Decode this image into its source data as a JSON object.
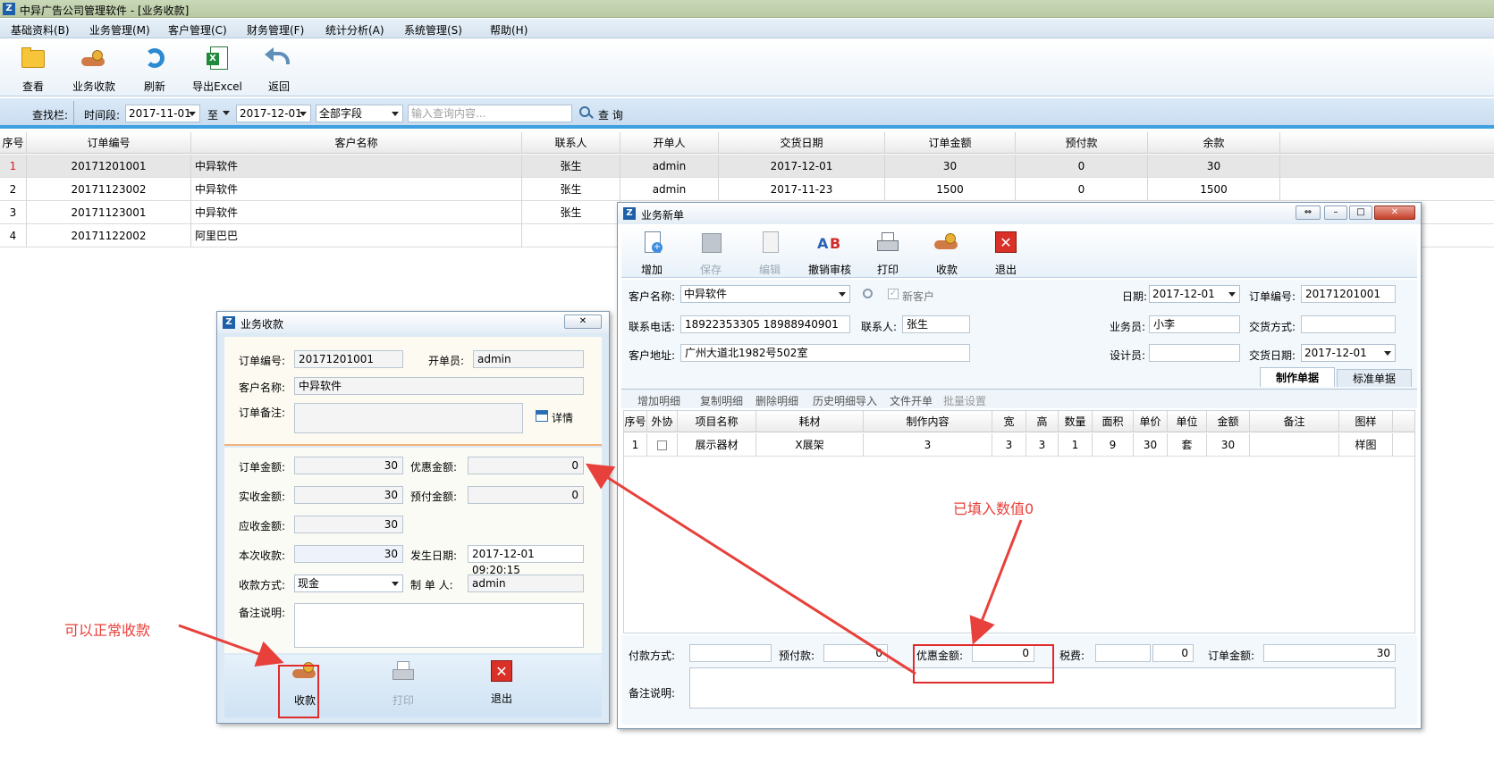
{
  "window": {
    "title": "中异广告公司管理软件 - [业务收款]",
    "menu": [
      "基础资料(B)",
      "业务管理(M)",
      "客户管理(C)",
      "财务管理(F)",
      "统计分析(A)",
      "系统管理(S)",
      "帮助(H)"
    ],
    "toolbar": [
      {
        "label": "查看",
        "icon": "folder-icon"
      },
      {
        "label": "业务收款",
        "icon": "money-hand-icon"
      },
      {
        "label": "刷新",
        "icon": "refresh-icon"
      },
      {
        "label": "导出Excel",
        "icon": "excel-icon"
      },
      {
        "label": "返回",
        "icon": "back-arrow-icon"
      }
    ]
  },
  "search": {
    "bar_label": "查找栏:",
    "period_label": "时间段:",
    "date_from": "2017-11-01",
    "to_label": "至",
    "date_to": "2017-12-01",
    "field": "全部字段",
    "placeholder": "输入查询内容...",
    "search_button": "查 询"
  },
  "grid": {
    "columns": [
      "序号",
      "订单编号",
      "客户名称",
      "联系人",
      "开单人",
      "交货日期",
      "订单金额",
      "预付款",
      "余款"
    ],
    "rows": [
      {
        "no": "1",
        "order": "20171201001",
        "customer": "中异软件",
        "contact": "张生",
        "creator": "admin",
        "date": "2017-12-01",
        "amount": "30",
        "prepay": "0",
        "balance": "30"
      },
      {
        "no": "2",
        "order": "20171123002",
        "customer": "中异软件",
        "contact": "张生",
        "creator": "admin",
        "date": "2017-11-23",
        "amount": "1500",
        "prepay": "0",
        "balance": "1500"
      },
      {
        "no": "3",
        "order": "20171123001",
        "customer": "中异软件",
        "contact": "张生",
        "creator": "",
        "date": "",
        "amount": "",
        "prepay": "",
        "balance": ""
      },
      {
        "no": "4",
        "order": "20171122002",
        "customer": "阿里巴巴",
        "contact": "",
        "creator": "",
        "date": "",
        "amount": "",
        "prepay": "",
        "balance": ""
      }
    ]
  },
  "payment_dialog": {
    "title": "业务收款",
    "order_no_label": "订单编号:",
    "order_no": "20171201001",
    "creator_label": "开单员:",
    "creator": "admin",
    "customer_label": "客户名称:",
    "customer": "中异软件",
    "remark_label": "订单备注:",
    "detail_button": "详情",
    "order_amount_label": "订单金额:",
    "order_amount": "30",
    "discount_label": "优惠金额:",
    "discount": "0",
    "actual_label": "实收金额:",
    "actual": "30",
    "prepay_label": "预付金额:",
    "prepay": "0",
    "receivable_label": "应收金额:",
    "receivable": "30",
    "this_time_label": "本次收款:",
    "this_time": "30",
    "occur_date_label": "发生日期:",
    "occur_date": "2017-12-01 09:20:15",
    "method_label": "收款方式:",
    "method": "现金",
    "maker_label": "制 单 人:",
    "maker": "admin",
    "note_label": "备注说明:",
    "buttons": [
      "收款",
      "打印",
      "退出"
    ]
  },
  "order_dialog": {
    "title": "业务新单",
    "toolbar": [
      "增加",
      "保存",
      "编辑",
      "撤销审核",
      "打印",
      "收款",
      "退出"
    ],
    "customer_label": "客户名称:",
    "customer": "中异软件",
    "new_customer_label": "新客户",
    "date_label": "日期:",
    "date": "2017-12-01",
    "order_no_label": "订单编号:",
    "order_no": "20171201001",
    "phone_label": "联系电话:",
    "phone": "18922353305 18988940901",
    "contact_label": "联系人:",
    "contact": "张生",
    "salesman_label": "业务员:",
    "salesman": "小李",
    "trade_label": "交货方式:",
    "address_label": "客户地址:",
    "address": "广州大道北1982号502室",
    "designer_label": "设计员:",
    "delivery_label": "交货日期:",
    "delivery": "2017-12-01",
    "tabs": [
      "制作单据",
      "标准单据"
    ],
    "detail_actions": [
      "增加明细",
      "复制明细",
      "删除明细",
      "历史明细导入",
      "文件开单",
      "批量设置"
    ],
    "detail_columns": [
      "序号",
      "外协",
      "项目名称",
      "耗材",
      "制作内容",
      "宽",
      "高",
      "数量",
      "面积",
      "单价",
      "单位",
      "金额",
      "备注",
      "图样"
    ],
    "detail_row": [
      "1",
      "",
      "展示器材",
      "X展架",
      "3",
      "3",
      "3",
      "1",
      "9",
      "30",
      "套",
      "30",
      "",
      "样图"
    ],
    "pay_method_label": "付款方式:",
    "prepay_label": "预付款:",
    "prepay": "0",
    "discount_label": "优惠金额:",
    "discount": "0",
    "tax_label": "税费:",
    "tax": "0",
    "order_amount_label": "订单金额:",
    "order_amount": "30",
    "note_label": "备注说明:"
  },
  "annotations": {
    "filled_zero": "已填入数值0",
    "can_collect": "可以正常收款"
  },
  "colors": {
    "accent": "#3ea0de",
    "annotation": "#e8403a"
  }
}
